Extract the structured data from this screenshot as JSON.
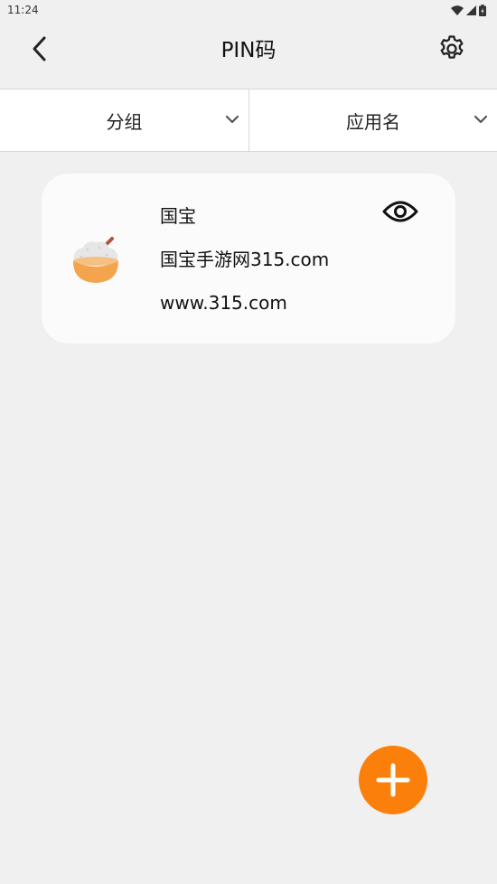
{
  "status_bar": {
    "time": "11:24",
    "icons": [
      "wifi-icon",
      "signal-icon",
      "battery-icon"
    ]
  },
  "app_bar": {
    "title": "PIN码",
    "back_icon": "chevron-left-icon",
    "settings_icon": "gear-icon"
  },
  "filters": [
    {
      "label": "分组",
      "icon": "chevron-down-icon"
    },
    {
      "label": "应用名",
      "icon": "chevron-down-icon"
    }
  ],
  "entries": [
    {
      "app_name": "国宝",
      "title": "国宝手游网315.com",
      "url": "www.315.com",
      "icon": "rice-bowl-icon",
      "action_icon": "eye-icon"
    }
  ],
  "fab": {
    "icon": "plus-icon"
  },
  "colors": {
    "background": "#f0f0f0",
    "surface": "#ffffff",
    "card": "#fbfbfb",
    "accent": "#fb7f0b",
    "divider": "#d6d6d6"
  }
}
